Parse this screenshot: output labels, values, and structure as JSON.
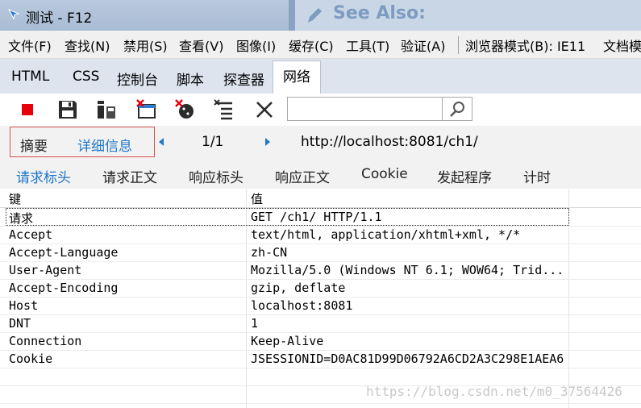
{
  "window": {
    "title": "测试 - F12",
    "background_hint": "See Also:"
  },
  "menu": [
    "文件(F)",
    "查找(N)",
    "禁用(S)",
    "查看(V)",
    "图像(I)",
    "缓存(C)",
    "工具(T)",
    "验证(A)",
    "浏览器模式(B): IE11",
    "文档模"
  ],
  "tabs": [
    "HTML",
    "CSS",
    "控制台",
    "脚本",
    "探查器",
    "网络"
  ],
  "active_tab": "网络",
  "toolbar": {
    "search_value": ""
  },
  "summary": {
    "summary_label": "摘要",
    "detail_label": "详细信息",
    "page": "1/1",
    "url": "http://localhost:8081/ch1/"
  },
  "subtabs": [
    "请求标头",
    "请求正文",
    "响应标头",
    "响应正文",
    "Cookie",
    "发起程序",
    "计时"
  ],
  "active_subtab": "请求标头",
  "table": {
    "key_header": "键",
    "value_header": "值",
    "rows": [
      {
        "key": "请求",
        "value": "GET /ch1/ HTTP/1.1"
      },
      {
        "key": "Accept",
        "value": "text/html, application/xhtml+xml, */*"
      },
      {
        "key": "Accept-Language",
        "value": "zh-CN"
      },
      {
        "key": "User-Agent",
        "value": "Mozilla/5.0 (Windows NT 6.1; WOW64; Trid..."
      },
      {
        "key": "Accept-Encoding",
        "value": "gzip, deflate"
      },
      {
        "key": "Host",
        "value": "localhost:8081"
      },
      {
        "key": "DNT",
        "value": "1"
      },
      {
        "key": "Connection",
        "value": "Keep-Alive"
      },
      {
        "key": "Cookie",
        "value": "JSESSIONID=D0AC81D99D06792A6CD2A3C298E1AEA6"
      }
    ]
  },
  "watermark": "https://blog.csdn.net/m0_37564426",
  "colors": {
    "accent": "#1f77c9",
    "stop": "#e8000b",
    "highlight_border": "#d9534f"
  }
}
